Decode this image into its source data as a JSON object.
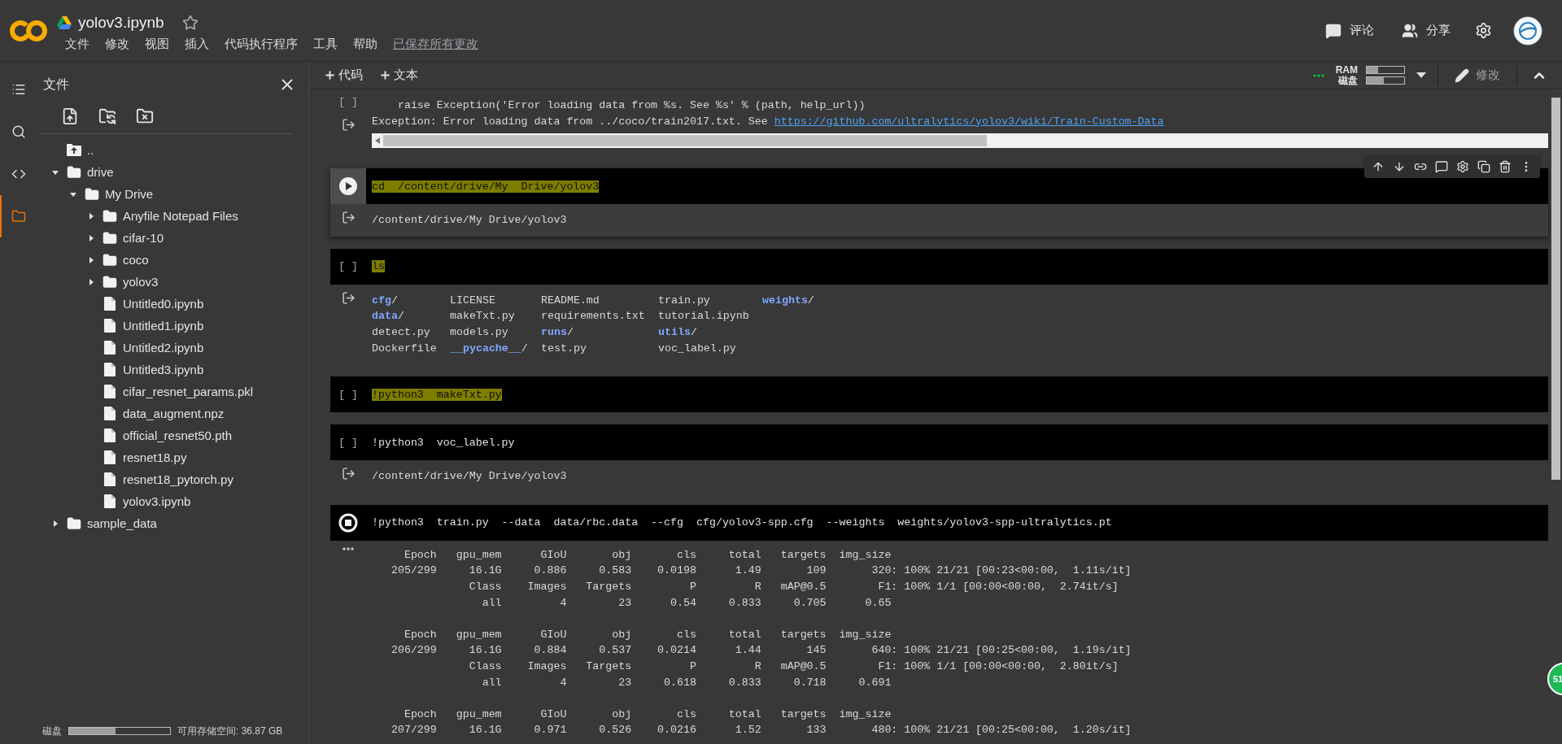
{
  "header": {
    "title": "yolov3.ipynb",
    "starred": false,
    "menu": [
      "文件",
      "修改",
      "视图",
      "插入",
      "代码执行程序",
      "工具",
      "帮助"
    ],
    "save_status": "已保存所有更改",
    "actions": [
      {
        "kind": "comment",
        "label": "评论"
      },
      {
        "kind": "share",
        "label": "分享"
      },
      {
        "kind": "settings"
      },
      {
        "kind": "avatar"
      }
    ]
  },
  "sidebar": {
    "rail": [
      {
        "kind": "toc",
        "selected": false
      },
      {
        "kind": "search",
        "selected": false
      },
      {
        "kind": "snippets",
        "selected": false
      },
      {
        "kind": "files",
        "selected": true
      }
    ],
    "panel": {
      "title": "文件",
      "tools": [
        {
          "kind": "upload"
        },
        {
          "kind": "refresh"
        },
        {
          "kind": "unmount"
        }
      ],
      "tree": [
        {
          "name": "..",
          "kind": "parent"
        },
        {
          "name": "drive",
          "kind": "folder",
          "expanded": true,
          "children": [
            {
              "name": "My Drive",
              "kind": "folder",
              "expanded": true,
              "children": [
                {
                  "name": "Anyfile Notepad Files",
                  "kind": "folder",
                  "expanded": false
                },
                {
                  "name": "cifar-10",
                  "kind": "folder",
                  "expanded": false
                },
                {
                  "name": "coco",
                  "kind": "folder",
                  "expanded": false
                },
                {
                  "name": "yolov3",
                  "kind": "folder",
                  "expanded": false
                },
                {
                  "name": "Untitled0.ipynb",
                  "kind": "file"
                },
                {
                  "name": "Untitled1.ipynb",
                  "kind": "file"
                },
                {
                  "name": "Untitled2.ipynb",
                  "kind": "file"
                },
                {
                  "name": "Untitled3.ipynb",
                  "kind": "file"
                },
                {
                  "name": "cifar_resnet_params.pkl",
                  "kind": "file"
                },
                {
                  "name": "data_augment.npz",
                  "kind": "file"
                },
                {
                  "name": "official_resnet50.pth",
                  "kind": "file"
                },
                {
                  "name": "resnet18.py",
                  "kind": "file"
                },
                {
                  "name": "resnet18_pytorch.py",
                  "kind": "file"
                },
                {
                  "name": "yolov3.ipynb",
                  "kind": "file"
                }
              ]
            }
          ]
        },
        {
          "name": "sample_data",
          "kind": "folder",
          "expanded": false
        }
      ]
    },
    "disk": {
      "label": "磁盘",
      "level": 0.46,
      "free": "可用存储空间: 36.87 GB"
    }
  },
  "toolbar": {
    "add": [
      "代码",
      "文本"
    ],
    "connected": true,
    "resources": [
      {
        "label": "RAM",
        "level": 0.3
      },
      {
        "label": "磁盘",
        "level": 0.45
      }
    ],
    "edit": "修改"
  },
  "cells": [
    {
      "kind": "idle",
      "prompt": "[ ]",
      "output": {
        "kind": "text",
        "scrollbar": true,
        "lines": [
          {
            "text": "    raise Exception('Error loading data from %s. See %s' % (path, help_url))"
          },
          {
            "text": "Exception: Error loading data from ../coco/train2017.txt. See ",
            "link": "https://github.com/ultralytics/yolov3/wiki/Train-Custom-Data"
          }
        ]
      }
    },
    {
      "kind": "focused",
      "code": "cd  /content/drive/My  Drive/yolov3",
      "highlighted": true,
      "output": {
        "kind": "text",
        "lines": [
          {
            "text": "/content/drive/My Drive/yolov3"
          }
        ]
      }
    },
    {
      "kind": "idle",
      "prompt": "[ ]",
      "code": "ls",
      "highlighted": true,
      "output": {
        "kind": "listing",
        "rows": [
          [
            {
              "name": "cfg",
              "suffix": "/",
              "dir": true
            },
            {
              "name": "LICENSE",
              "dir": false
            },
            {
              "name": "README.md",
              "dir": false
            },
            {
              "name": "train.py",
              "dir": false
            },
            {
              "name": "weights",
              "suffix": "/",
              "dir": true
            }
          ],
          [
            {
              "name": "data",
              "suffix": "/",
              "dir": true
            },
            {
              "name": "makeTxt.py",
              "dir": false
            },
            {
              "name": "requirements.txt",
              "dir": false
            },
            {
              "name": "tutorial.ipynb",
              "dir": false
            }
          ],
          [
            {
              "name": "detect.py",
              "dir": false
            },
            {
              "name": "models.py",
              "dir": false
            },
            {
              "name": "runs",
              "suffix": "/",
              "dir": true
            },
            {
              "name": "utils",
              "suffix": "/",
              "dir": true
            }
          ],
          [
            {
              "name": "Dockerfile",
              "dir": false
            },
            {
              "name": "__pycache__",
              "suffix": "/",
              "dir": true
            },
            {
              "name": "test.py",
              "dir": false
            },
            {
              "name": "voc_label.py",
              "dir": false
            }
          ]
        ]
      }
    },
    {
      "kind": "idle",
      "prompt": "[ ]",
      "code": "!python3  makeTxt.py",
      "highlighted": true
    },
    {
      "kind": "idle",
      "prompt": "[ ]",
      "code": "!python3  voc_label.py",
      "highlighted": false,
      "output": {
        "kind": "text",
        "lines": [
          {
            "text": "/content/drive/My Drive/yolov3"
          }
        ]
      }
    },
    {
      "kind": "running",
      "code": "!python3  train.py  --data  data/rbc.data  --cfg  cfg/yolov3-spp.cfg  --weights  weights/yolov3-spp-ultralytics.pt",
      "highlighted": false,
      "output": {
        "kind": "log",
        "blocks": [
          [
            "     Epoch   gpu_mem      GIoU       obj       cls     total   targets  img_size",
            "   205/299     16.1G     0.886     0.583    0.0198      1.49       109       320: 100% 21/21 [00:23<00:00,  1.11s/it]",
            "               Class    Images   Targets         P         R   mAP@0.5        F1: 100% 1/1 [00:00<00:00,  2.74it/s]",
            "                 all         4        23      0.54     0.833     0.705      0.65"
          ],
          [
            "     Epoch   gpu_mem      GIoU       obj       cls     total   targets  img_size",
            "   206/299     16.1G     0.884     0.537    0.0214      1.44       145       640: 100% 21/21 [00:25<00:00,  1.19s/it]",
            "               Class    Images   Targets         P         R   mAP@0.5        F1: 100% 1/1 [00:00<00:00,  2.80it/s]",
            "                 all         4        23     0.618     0.833     0.718     0.691"
          ],
          [
            "     Epoch   gpu_mem      GIoU       obj       cls     total   targets  img_size",
            "   207/299     16.1G     0.971     0.526    0.0216      1.52       133       480: 100% 21/21 [00:25<00:00,  1.20s/it]"
          ]
        ]
      }
    }
  ],
  "badge": "51"
}
